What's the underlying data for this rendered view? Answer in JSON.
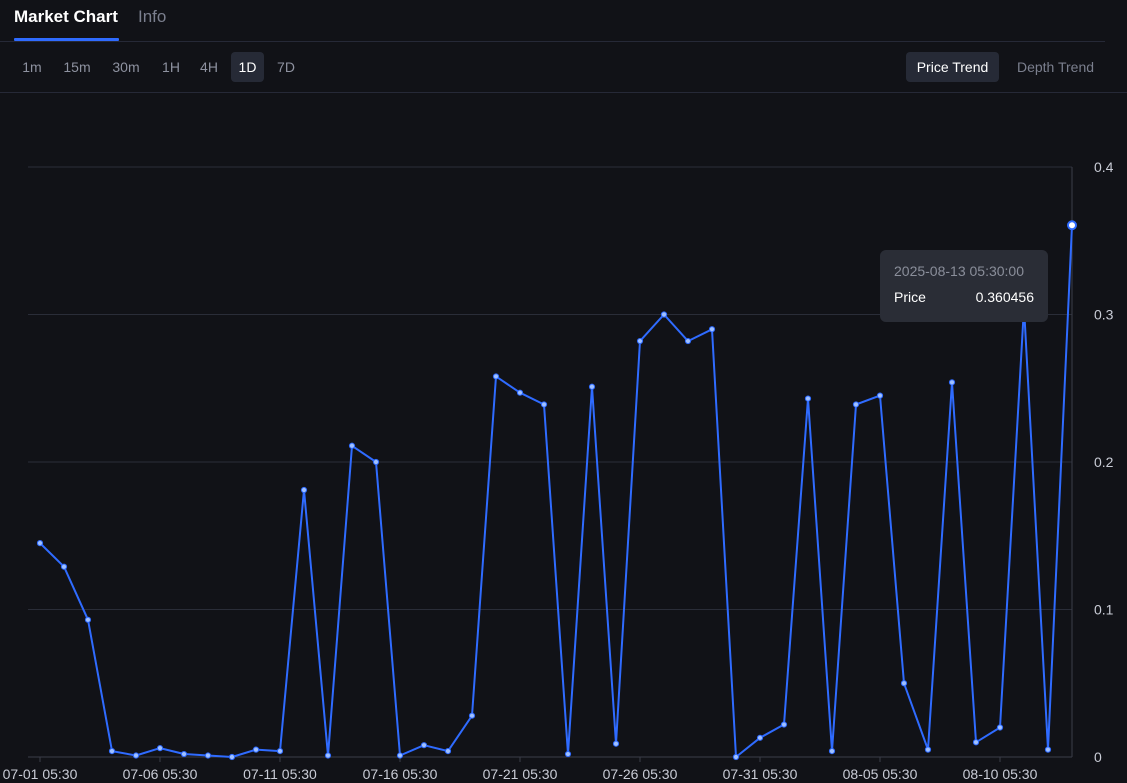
{
  "tabs": {
    "market_chart": "Market Chart",
    "info": "Info"
  },
  "intervals": [
    {
      "label": "1m",
      "active": false
    },
    {
      "label": "15m",
      "active": false
    },
    {
      "label": "30m",
      "active": false
    },
    {
      "label": "1H",
      "active": false
    },
    {
      "label": "4H",
      "active": false
    },
    {
      "label": "1D",
      "active": true
    },
    {
      "label": "7D",
      "active": false
    }
  ],
  "modes": {
    "price_trend": "Price Trend",
    "depth_trend": "Depth Trend",
    "active": "price_trend"
  },
  "tooltip": {
    "date": "2025-08-13 05:30:00",
    "label": "Price",
    "value": "0.360456"
  },
  "colors": {
    "line": "#2f6bff",
    "background": "#111217",
    "grid": "#2a2d38",
    "axis_text": "#c9ccd6"
  },
  "chart_data": {
    "type": "line",
    "x": [
      "07-01",
      "07-02",
      "07-03",
      "07-04",
      "07-05",
      "07-06",
      "07-07",
      "07-08",
      "07-09",
      "07-10",
      "07-11",
      "07-12",
      "07-13",
      "07-14",
      "07-15",
      "07-16",
      "07-17",
      "07-18",
      "07-19",
      "07-20",
      "07-21",
      "07-22",
      "07-23",
      "07-24",
      "07-25",
      "07-26",
      "07-27",
      "07-28",
      "07-29",
      "07-30",
      "07-31",
      "08-01",
      "08-02",
      "08-03",
      "08-04",
      "08-05",
      "08-06",
      "08-07",
      "08-08",
      "08-09",
      "08-10",
      "08-11",
      "08-12",
      "08-13"
    ],
    "values": [
      0.145,
      0.129,
      0.093,
      0.004,
      0.001,
      0.006,
      0.002,
      0.001,
      0.0,
      0.005,
      0.004,
      0.181,
      0.001,
      0.211,
      0.2,
      0.001,
      0.008,
      0.004,
      0.028,
      0.258,
      0.247,
      0.239,
      0.002,
      0.251,
      0.009,
      0.282,
      0.3,
      0.282,
      0.29,
      0.0,
      0.013,
      0.022,
      0.243,
      0.004,
      0.239,
      0.245,
      0.05,
      0.005,
      0.254,
      0.01,
      0.02,
      0.305,
      0.005,
      0.3605
    ],
    "xticks": [
      "07-01 05:30",
      "07-06 05:30",
      "07-11 05:30",
      "07-16 05:30",
      "07-21 05:30",
      "07-26 05:30",
      "07-31 05:30",
      "08-05 05:30",
      "08-10 05:30"
    ],
    "xtick_indices": [
      0,
      5,
      10,
      15,
      20,
      25,
      30,
      35,
      40
    ],
    "yticks": [
      "0",
      "0.1",
      "0.2",
      "0.3",
      "0.4"
    ],
    "ylim": [
      0,
      0.4
    ],
    "highlight_index": 43,
    "grid": true
  }
}
